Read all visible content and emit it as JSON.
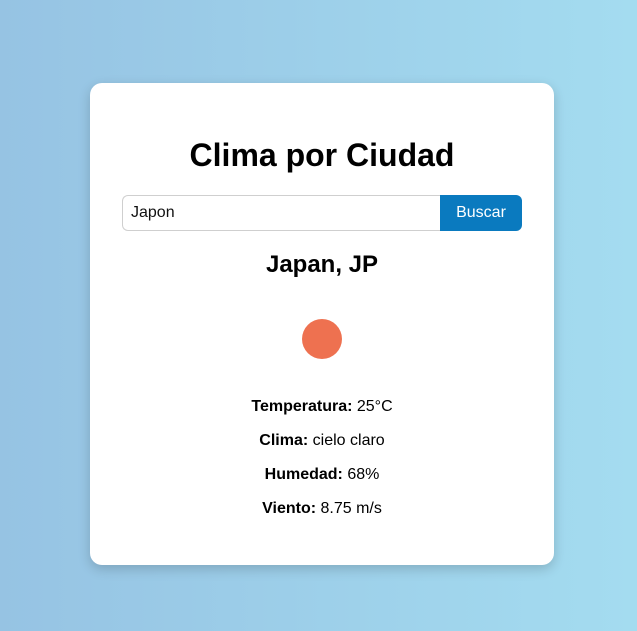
{
  "app": {
    "title": "Clima por Ciudad"
  },
  "search": {
    "value": "Japon",
    "button_label": "Buscar"
  },
  "result": {
    "city": "Japan, JP",
    "icon": "sun-icon",
    "icon_color": "#ee7150",
    "temperature_label": "Temperatura:",
    "temperature_value": "25°C",
    "weather_label": "Clima:",
    "weather_value": "cielo claro",
    "humidity_label": "Humedad:",
    "humidity_value": "68%",
    "wind_label": "Viento:",
    "wind_value": "8.75 m/s"
  },
  "colors": {
    "accent": "#0a7abf",
    "background_start": "#96c3e3",
    "background_end": "#a4dcf0",
    "card": "#ffffff"
  }
}
